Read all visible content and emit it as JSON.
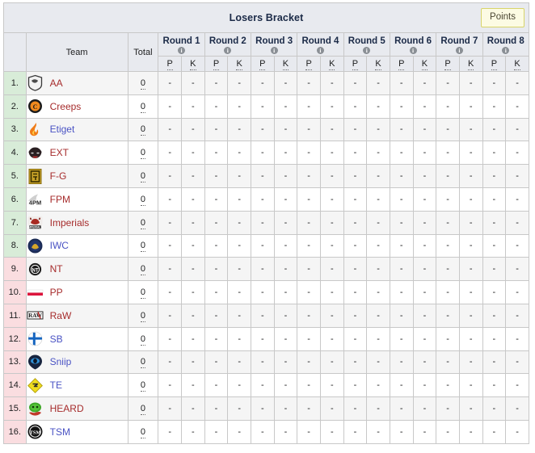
{
  "header": {
    "title": "Losers Bracket",
    "points_button": "Points",
    "info_icon_glyph": "i",
    "info_icon_name": "info-icon"
  },
  "columns": {
    "rank_label": "",
    "team_label": "Team",
    "total_label": "Total",
    "sub_p": "P",
    "sub_k": "K",
    "rounds": [
      "Round 1",
      "Round 2",
      "Round 3",
      "Round 4",
      "Round 5",
      "Round 6",
      "Round 7",
      "Round 8"
    ]
  },
  "empty_cell": "-",
  "colors": {
    "title_bar": "#e8eaef",
    "points_button_bg": "#fcfbe3",
    "points_button_border": "#d8d46a",
    "rank_qualified": "#d8ecd8",
    "rank_eliminated": "#fadde0",
    "row_odd": "#f5f5f5",
    "row_even": "#ffffff",
    "grid_line": "#c8c8c8",
    "link_red": "#a62c2c",
    "link_blue": "#4a53c4"
  },
  "rows": [
    {
      "rank": "1.",
      "team": "AA",
      "logo": "aa-shield-logo",
      "link": "red",
      "total": "0",
      "zone": "green",
      "scores": [
        "-",
        "-",
        "-",
        "-",
        "-",
        "-",
        "-",
        "-",
        "-",
        "-",
        "-",
        "-",
        "-",
        "-",
        "-",
        "-"
      ]
    },
    {
      "rank": "2.",
      "team": "Creeps",
      "logo": "creeps-logo",
      "link": "red",
      "total": "0",
      "zone": "green",
      "scores": [
        "-",
        "-",
        "-",
        "-",
        "-",
        "-",
        "-",
        "-",
        "-",
        "-",
        "-",
        "-",
        "-",
        "-",
        "-",
        "-"
      ]
    },
    {
      "rank": "3.",
      "team": "Etiget",
      "logo": "etiget-flame-logo",
      "link": "blue",
      "total": "0",
      "zone": "green",
      "scores": [
        "-",
        "-",
        "-",
        "-",
        "-",
        "-",
        "-",
        "-",
        "-",
        "-",
        "-",
        "-",
        "-",
        "-",
        "-",
        "-"
      ]
    },
    {
      "rank": "4.",
      "team": "EXT",
      "logo": "ext-mask-logo",
      "link": "red",
      "total": "0",
      "zone": "green",
      "scores": [
        "-",
        "-",
        "-",
        "-",
        "-",
        "-",
        "-",
        "-",
        "-",
        "-",
        "-",
        "-",
        "-",
        "-",
        "-",
        "-"
      ]
    },
    {
      "rank": "5.",
      "team": "F-G",
      "logo": "fg-square-logo",
      "link": "red",
      "total": "0",
      "zone": "green",
      "scores": [
        "-",
        "-",
        "-",
        "-",
        "-",
        "-",
        "-",
        "-",
        "-",
        "-",
        "-",
        "-",
        "-",
        "-",
        "-",
        "-"
      ]
    },
    {
      "rank": "6.",
      "team": "FPM",
      "logo": "fpm-logo",
      "link": "red",
      "total": "0",
      "zone": "green",
      "scores": [
        "-",
        "-",
        "-",
        "-",
        "-",
        "-",
        "-",
        "-",
        "-",
        "-",
        "-",
        "-",
        "-",
        "-",
        "-",
        "-"
      ]
    },
    {
      "rank": "7.",
      "team": "Imperials",
      "logo": "imperials-bull-logo",
      "link": "red",
      "total": "0",
      "zone": "green",
      "scores": [
        "-",
        "-",
        "-",
        "-",
        "-",
        "-",
        "-",
        "-",
        "-",
        "-",
        "-",
        "-",
        "-",
        "-",
        "-",
        "-"
      ]
    },
    {
      "rank": "8.",
      "team": "IWC",
      "logo": "iwc-circle-logo",
      "link": "blue",
      "total": "0",
      "zone": "green",
      "scores": [
        "-",
        "-",
        "-",
        "-",
        "-",
        "-",
        "-",
        "-",
        "-",
        "-",
        "-",
        "-",
        "-",
        "-",
        "-",
        "-"
      ]
    },
    {
      "rank": "9.",
      "team": "NT",
      "logo": "nt-circle-logo",
      "link": "red",
      "total": "0",
      "zone": "red",
      "scores": [
        "-",
        "-",
        "-",
        "-",
        "-",
        "-",
        "-",
        "-",
        "-",
        "-",
        "-",
        "-",
        "-",
        "-",
        "-",
        "-"
      ]
    },
    {
      "rank": "10.",
      "team": "PP",
      "logo": "pp-flag-logo",
      "link": "red",
      "total": "0",
      "zone": "red",
      "scores": [
        "-",
        "-",
        "-",
        "-",
        "-",
        "-",
        "-",
        "-",
        "-",
        "-",
        "-",
        "-",
        "-",
        "-",
        "-",
        "-"
      ]
    },
    {
      "rank": "11.",
      "team": "RaW",
      "logo": "raw-text-logo",
      "link": "red",
      "total": "0",
      "zone": "red",
      "scores": [
        "-",
        "-",
        "-",
        "-",
        "-",
        "-",
        "-",
        "-",
        "-",
        "-",
        "-",
        "-",
        "-",
        "-",
        "-",
        "-"
      ]
    },
    {
      "rank": "12.",
      "team": "SB",
      "logo": "sb-cross-logo",
      "link": "blue",
      "total": "0",
      "zone": "red",
      "scores": [
        "-",
        "-",
        "-",
        "-",
        "-",
        "-",
        "-",
        "-",
        "-",
        "-",
        "-",
        "-",
        "-",
        "-",
        "-",
        "-"
      ]
    },
    {
      "rank": "13.",
      "team": "Sniip",
      "logo": "sniip-circle-logo",
      "link": "blue",
      "total": "0",
      "zone": "red",
      "scores": [
        "-",
        "-",
        "-",
        "-",
        "-",
        "-",
        "-",
        "-",
        "-",
        "-",
        "-",
        "-",
        "-",
        "-",
        "-",
        "-"
      ]
    },
    {
      "rank": "14.",
      "team": "TE",
      "logo": "te-diamond-logo",
      "link": "blue",
      "total": "0",
      "zone": "red",
      "scores": [
        "-",
        "-",
        "-",
        "-",
        "-",
        "-",
        "-",
        "-",
        "-",
        "-",
        "-",
        "-",
        "-",
        "-",
        "-",
        "-"
      ]
    },
    {
      "rank": "15.",
      "team": "HEARD",
      "logo": "heard-logo",
      "link": "red",
      "total": "0",
      "zone": "red",
      "scores": [
        "-",
        "-",
        "-",
        "-",
        "-",
        "-",
        "-",
        "-",
        "-",
        "-",
        "-",
        "-",
        "-",
        "-",
        "-",
        "-"
      ]
    },
    {
      "rank": "16.",
      "team": "TSM",
      "logo": "tsm-circle-logo",
      "link": "blue",
      "total": "0",
      "zone": "red",
      "scores": [
        "-",
        "-",
        "-",
        "-",
        "-",
        "-",
        "-",
        "-",
        "-",
        "-",
        "-",
        "-",
        "-",
        "-",
        "-",
        "-"
      ]
    }
  ]
}
